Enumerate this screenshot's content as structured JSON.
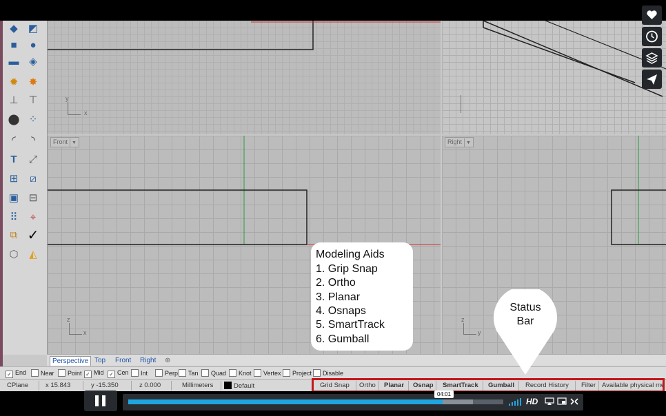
{
  "viewports": {
    "front_label": "Front",
    "right_label": "Right",
    "top_axes": {
      "y": "y",
      "x": "x"
    },
    "front_axes": {
      "z": "z",
      "x": "x"
    },
    "right_axes": {
      "z": "z",
      "y": "y"
    }
  },
  "viewport_tabs": [
    "Perspective",
    "Top",
    "Front",
    "Right"
  ],
  "osnaps": [
    {
      "label": "End",
      "checked": true
    },
    {
      "label": "Near",
      "checked": false
    },
    {
      "label": "Point",
      "checked": false
    },
    {
      "label": "Mid",
      "checked": true
    },
    {
      "label": "Cen",
      "checked": true
    },
    {
      "label": "Int",
      "checked": false
    },
    {
      "label": "Perp",
      "checked": false
    },
    {
      "label": "Tan",
      "checked": false
    },
    {
      "label": "Quad",
      "checked": false
    },
    {
      "label": "Knot",
      "checked": false
    },
    {
      "label": "Vertex",
      "checked": false
    },
    {
      "label": "Project",
      "checked": false
    },
    {
      "label": "Disable",
      "checked": false
    }
  ],
  "statusbar": {
    "cplane": "CPlane",
    "x": "x 15.843",
    "y": "y -15.350",
    "z": "z 0.000",
    "units": "Millimeters",
    "layer": "Default",
    "grid_snap": "Grid Snap",
    "ortho": "Ortho",
    "planar": "Planar",
    "osnap": "Osnap",
    "smarttrack": "SmartTrack",
    "gumball": "Gumball",
    "record_history": "Record History",
    "filter": "Filter",
    "memory": "Available physical me"
  },
  "callouts": {
    "modeling_aids": {
      "title": "Modeling Aids",
      "items": [
        "1. Grip Snap",
        "2. Ortho",
        "3. Planar",
        "4. Osnaps",
        "5. SmartTrack",
        "6. Gumball"
      ]
    },
    "status_bar": {
      "line1": "Status",
      "line2": "Bar"
    }
  },
  "player": {
    "time": "04:01",
    "hd": "HD",
    "progress_fraction": 0.84
  },
  "colors": {
    "highlight_red": "#c4161c",
    "progress_blue": "#1fa6e0",
    "x_axis_red": "#d03030",
    "z_axis_green": "#2a9a3a"
  }
}
